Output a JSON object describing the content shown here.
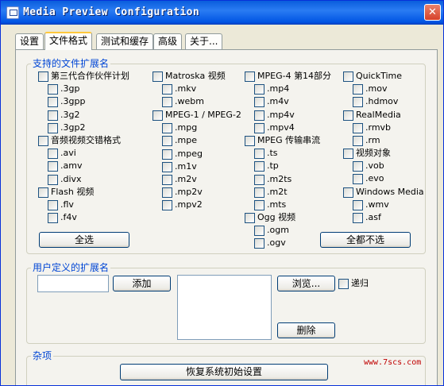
{
  "window": {
    "title": "Media Preview Configuration",
    "close_glyph": "✕"
  },
  "tabs": [
    "设置",
    "文件格式",
    "测试和缓存",
    "高级",
    "关于..."
  ],
  "formats": {
    "legend": "支持的文件扩展名",
    "groups": [
      {
        "name": "第三代合作伙伴计划",
        "exts": [
          ".3gp",
          ".3gpp",
          ".3g2",
          ".3gp2"
        ]
      },
      {
        "name": "音频视频交错格式",
        "exts": [
          ".avi",
          ".amv",
          ".divx"
        ]
      },
      {
        "name": "Flash 视频",
        "exts": [
          ".flv",
          ".f4v"
        ]
      },
      {
        "name": "Matroska 视频",
        "exts": [
          ".mkv",
          ".webm"
        ]
      },
      {
        "name": "MPEG-1 / MPEG-2",
        "exts": [
          ".mpg",
          ".mpe",
          ".mpeg",
          ".m1v",
          ".m2v",
          ".mp2v",
          ".mpv2"
        ]
      },
      {
        "name": "MPEG-4 第14部分",
        "exts": [
          ".mp4",
          ".m4v",
          ".mp4v",
          ".mpv4"
        ]
      },
      {
        "name": "MPEG 传输串流",
        "exts": [
          ".ts",
          ".tp",
          ".m2ts",
          ".m2t",
          ".mts"
        ]
      },
      {
        "name": "Ogg 视频",
        "exts": [
          ".ogm",
          ".ogv"
        ]
      },
      {
        "name": "QuickTime",
        "exts": [
          ".mov",
          ".hdmov"
        ]
      },
      {
        "name": "RealMedia",
        "exts": [
          ".rmvb",
          ".rm"
        ]
      },
      {
        "name": "视频对象",
        "exts": [
          ".vob",
          ".evo"
        ]
      },
      {
        "name": "Windows Media",
        "exts": [
          ".wmv",
          ".asf"
        ]
      }
    ],
    "select_all_label": "全选",
    "select_none_label": "全都不选"
  },
  "custom": {
    "legend": "用户定义的扩展名",
    "input_value": "",
    "add_label": "添加",
    "browse_label": "浏览...",
    "recursive_label": "递归",
    "delete_label": "删除"
  },
  "misc": {
    "legend": "杂项",
    "restore_label": "恢复系统初始设置"
  },
  "watermark": "www.7scs.com"
}
